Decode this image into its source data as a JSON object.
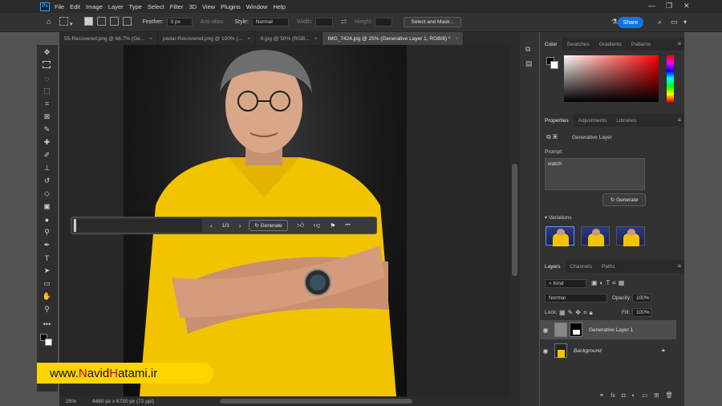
{
  "app": {
    "logo": "Ps"
  },
  "menu": [
    "File",
    "Edit",
    "Image",
    "Layer",
    "Type",
    "Select",
    "Filter",
    "3D",
    "View",
    "Plugins",
    "Window",
    "Help"
  ],
  "window_controls": [
    "—",
    "❐",
    "✕"
  ],
  "options": {
    "feather_label": "Feather:",
    "feather_value": "0 px",
    "antialias_label": "Anti-alias",
    "style_label": "Style:",
    "style_value": "Normal",
    "width_label": "Width:",
    "height_label": "Height:",
    "select_mask": "Select and Mask...",
    "share": "Share"
  },
  "tabs": [
    {
      "label": "55-Recovered.png @ 66.7% (Ge...",
      "close": "×"
    },
    {
      "label": "pedar-Recovered.png @ 100% (...",
      "close": "×"
    },
    {
      "label": "6.jpg @ 50% (RGB...",
      "close": "×"
    },
    {
      "label": "IMG_7424.jpg @ 25% (Generative Layer 1, RGB/8) *",
      "close": "×"
    }
  ],
  "contextbar": {
    "counter": "1/3",
    "generate": "Generate",
    "more": "•••"
  },
  "status": {
    "zoom": "25%",
    "info": "4480 px x 6720 px (72 ppi)"
  },
  "watermark": {
    "pre": "www.",
    "h1": "N",
    "mid1": "avid",
    "h2": "H",
    "mid2": "atami.ir"
  },
  "color_panel": {
    "tabs": [
      "Color",
      "Swatches",
      "Gradients",
      "Patterns"
    ]
  },
  "properties": {
    "tabs": [
      "Properties",
      "Adjustments",
      "Libraries"
    ],
    "layer_type": "Generative Layer",
    "prompt_label": "Prompt:",
    "prompt_value": "watch",
    "generate": "Generate",
    "variations": "Variations"
  },
  "layers_panel": {
    "tabs": [
      "Layers",
      "Channels",
      "Paths"
    ],
    "kind": "Kind",
    "blend": "Normal",
    "opacity_label": "Opacity:",
    "opacity": "100%",
    "lock_label": "Lock:",
    "fill_label": "Fill:",
    "fill": "100%",
    "layers": [
      {
        "name": "Generative Layer 1",
        "selected": true
      },
      {
        "name": "Background",
        "selected": false,
        "italic": true
      }
    ]
  },
  "colors": {
    "accent": "#1473e6",
    "shirt": "#f2c400",
    "watermark_bg": "#ffd500"
  }
}
